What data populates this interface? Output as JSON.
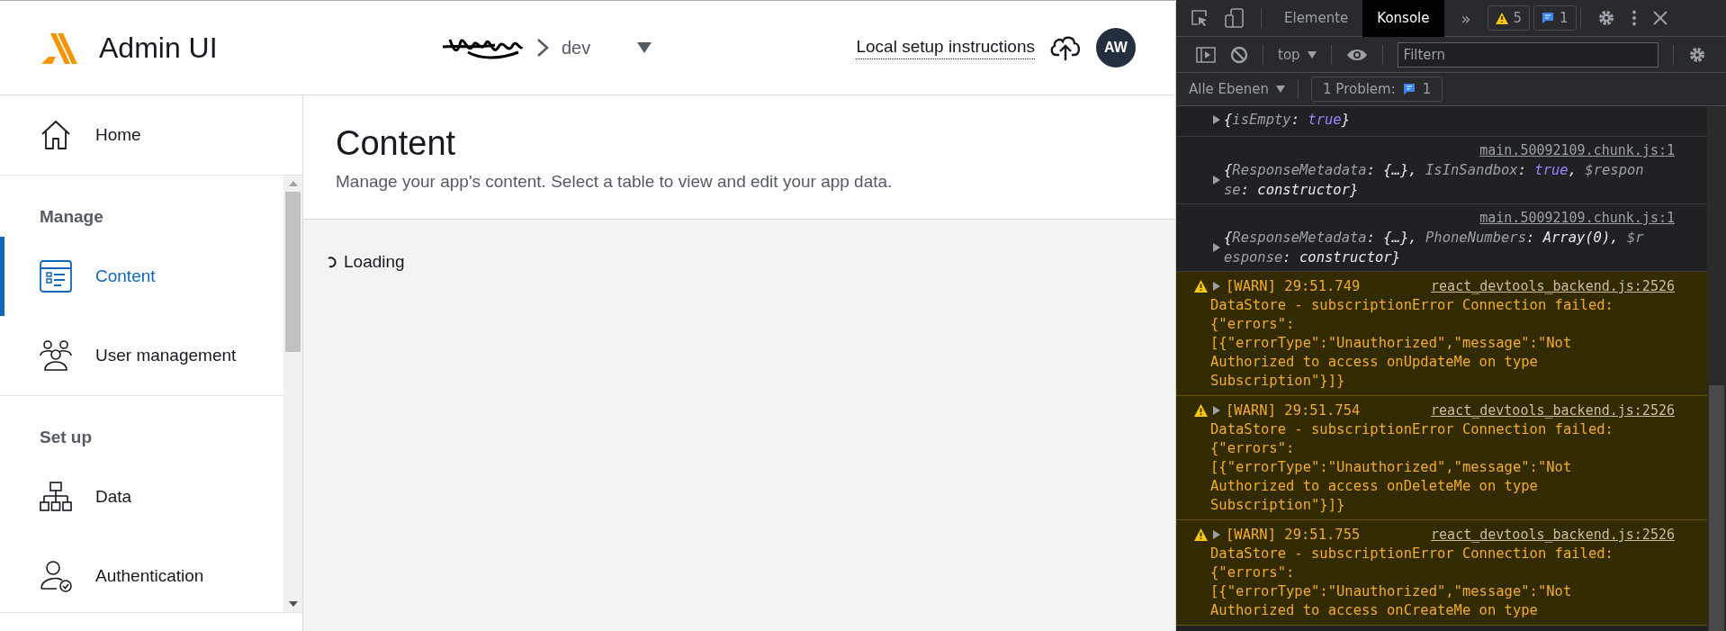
{
  "header": {
    "app_name": "Admin UI",
    "environment": "dev",
    "setup_link": "Local setup instructions",
    "avatar_initials": "AW"
  },
  "sidebar": {
    "home": {
      "label": "Home",
      "kind": "home",
      "selected": false
    },
    "sections": [
      {
        "title": "Manage",
        "items": [
          {
            "label": "Content",
            "kind": "content",
            "selected": true
          },
          {
            "label": "User management",
            "kind": "users",
            "selected": false
          }
        ]
      },
      {
        "title": "Set up",
        "items": [
          {
            "label": "Data",
            "kind": "data",
            "selected": false
          },
          {
            "label": "Authentication",
            "kind": "auth",
            "selected": false
          }
        ]
      }
    ]
  },
  "page": {
    "title": "Content",
    "subtitle": "Manage your app's content. Select a table to view and edit your app data.",
    "status": "Loading"
  },
  "devtools": {
    "tabs": [
      {
        "label": "Elemente",
        "selected": false
      },
      {
        "label": "Konsole",
        "selected": true
      }
    ],
    "more": "»",
    "warning_count": "5",
    "message_count": "1",
    "context": "top",
    "filter": {
      "placeholder": "Filtern"
    },
    "levels": "Alle Ebenen",
    "problems": {
      "label": "1 Problem:",
      "count": "1"
    },
    "console": [
      {
        "kind": "log",
        "parts": [
          {
            "kind": "punct",
            "text": "{"
          },
          {
            "kind": "key",
            "text": "isEmpty"
          },
          {
            "kind": "punct",
            "text": ": "
          },
          {
            "kind": "bool",
            "text": "true"
          },
          {
            "kind": "punct",
            "text": "}"
          }
        ]
      },
      {
        "kind": "log",
        "source": "main.50092109.chunk.js:1",
        "parts": [
          {
            "kind": "punct",
            "text": "{"
          },
          {
            "kind": "key",
            "text": "ResponseMetadata"
          },
          {
            "kind": "punct",
            "text": ": {…}, "
          },
          {
            "kind": "key",
            "text": "IsInSandbox"
          },
          {
            "kind": "punct",
            "text": ": "
          },
          {
            "kind": "bool",
            "text": "true"
          },
          {
            "kind": "punct",
            "text": ", "
          },
          {
            "kind": "key",
            "text": "$response"
          },
          {
            "kind": "punct",
            "text": ": constructor}"
          }
        ]
      },
      {
        "kind": "log",
        "source": "main.50092109.chunk.js:1",
        "parts": [
          {
            "kind": "punct",
            "text": "{"
          },
          {
            "kind": "key",
            "text": "ResponseMetadata"
          },
          {
            "kind": "punct",
            "text": ": {…}, "
          },
          {
            "kind": "key",
            "text": "PhoneNumbers"
          },
          {
            "kind": "punct",
            "text": ": Array(0), "
          },
          {
            "kind": "key",
            "text": "$response"
          },
          {
            "kind": "punct",
            "text": ": constructor}"
          }
        ]
      },
      {
        "kind": "warn",
        "prefix": "[WARN] 29:51.749",
        "source": "react_devtools_backend.js:2526",
        "message": "DataStore - subscriptionError Connection failed: {\"errors\": [{\"errorType\":\"Unauthorized\",\"message\":\"Not Authorized to access onUpdateMe on type Subscription\"}]}"
      },
      {
        "kind": "warn",
        "prefix": "[WARN] 29:51.754",
        "source": "react_devtools_backend.js:2526",
        "message": "DataStore - subscriptionError Connection failed: {\"errors\": [{\"errorType\":\"Unauthorized\",\"message\":\"Not Authorized to access onDeleteMe on type Subscription\"}]}"
      },
      {
        "kind": "warn",
        "prefix": "[WARN] 29:51.755",
        "source": "react_devtools_backend.js:2526",
        "message": "DataStore - subscriptionError Connection failed: {\"errors\": [{\"errorType\":\"Unauthorized\",\"message\":\"Not Authorized to access onCreateMe on type"
      }
    ]
  }
}
